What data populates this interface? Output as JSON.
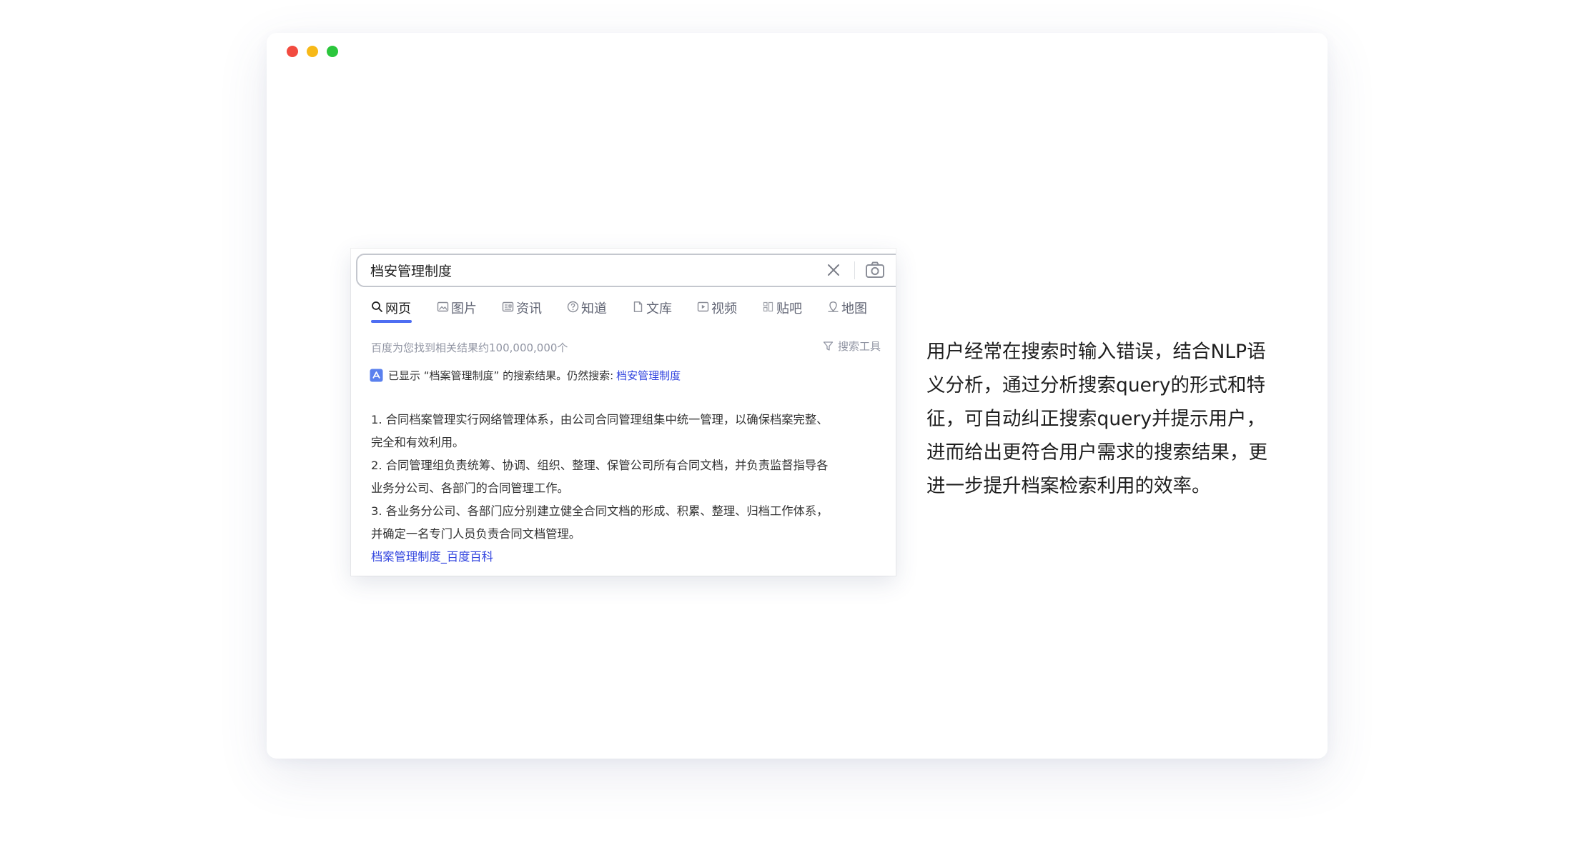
{
  "window": {
    "dot_colors": [
      "#f24b40",
      "#f7b918",
      "#2bc63c"
    ]
  },
  "search": {
    "query": "档安管理制度"
  },
  "tabs": [
    {
      "label": "网页",
      "icon": "search-icon"
    },
    {
      "label": "图片",
      "icon": "image-icon"
    },
    {
      "label": "资讯",
      "icon": "news-icon"
    },
    {
      "label": "知道",
      "icon": "question-icon"
    },
    {
      "label": "文库",
      "icon": "document-icon"
    },
    {
      "label": "视频",
      "icon": "video-icon"
    },
    {
      "label": "贴吧",
      "icon": "tieba-icon"
    },
    {
      "label": "地图",
      "icon": "map-icon"
    }
  ],
  "results": {
    "count_text": "百度为您找到相关结果约100,000,000个",
    "tools_label": "搜索工具",
    "correction_text": "已显示 “档案管理制度” 的搜索结果。仍然搜索:",
    "correction_link": "档安管理制度"
  },
  "snippet": {
    "lines": [
      "1. 合同档案管理实行网络管理体系，由公司合同管理组集中统一管理，以确保档案完整、",
      "完全和有效利用。",
      "2. 合同管理组负责统筹、协调、组织、整理、保管公司所有合同文档，并负责监督指导各",
      "业务分公司、各部门的合同管理工作。",
      "3. 各业务分公司、各部门应分别建立健全合同文档的形成、积累、整理、归档工作体系，",
      "并确定一名专门人员负责合同文档管理。"
    ],
    "link": "档案管理制度_百度百科"
  },
  "description": {
    "lines": [
      "用户经常在搜索时输入错误，结合NLP语",
      "义分析，通过分析搜索query的形式和特",
      "征，可自动纠正搜索query并提示用户，",
      "进而给出更符合用户需求的搜索结果，更",
      "进一步提升档案检索利用的效率。"
    ]
  },
  "colors": {
    "accent": "#4e6ef2",
    "link": "#3245df"
  }
}
